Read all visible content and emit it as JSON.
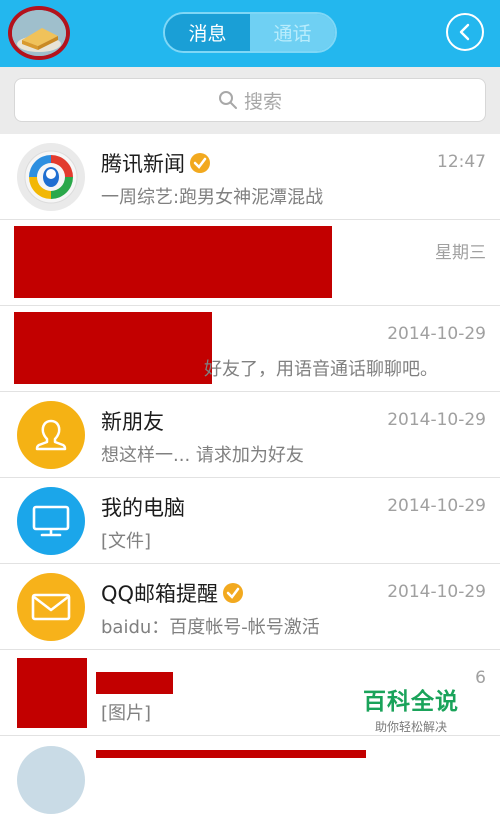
{
  "header": {
    "tabs": [
      {
        "label": "消息",
        "active": true
      },
      {
        "label": "通话",
        "active": false
      }
    ],
    "accent_color": "#23b7ee"
  },
  "search": {
    "placeholder": "搜索"
  },
  "chats": [
    {
      "name": "腾讯新闻",
      "preview": "一周综艺:跑男女神泥潭混战",
      "time": "12:47",
      "verified": true,
      "icon": "tencent-news-icon"
    },
    {
      "name": "",
      "preview": "",
      "time": "星期三",
      "verified": false,
      "icon": "redacted-avatar"
    },
    {
      "name": "",
      "preview": "好友了，用语音通话聊聊吧。",
      "time": "2014-10-29",
      "verified": false,
      "icon": "redacted-avatar"
    },
    {
      "name": "新朋友",
      "preview": "想这样一... 请求加为好友",
      "time": "2014-10-29",
      "verified": false,
      "icon": "new-friend-icon"
    },
    {
      "name": "我的电脑",
      "preview": "[文件]",
      "time": "2014-10-29",
      "verified": false,
      "icon": "computer-icon"
    },
    {
      "name": "QQ邮箱提醒",
      "preview": "baidu：百度帐号-帐号激活",
      "time": "2014-10-29",
      "verified": true,
      "icon": "mail-icon"
    },
    {
      "name": "",
      "preview": "[图片]",
      "time": "6",
      "verified": false,
      "icon": "redacted-avatar"
    }
  ],
  "watermark": {
    "title": "百科全说",
    "subtitle": "助你轻松解决"
  }
}
